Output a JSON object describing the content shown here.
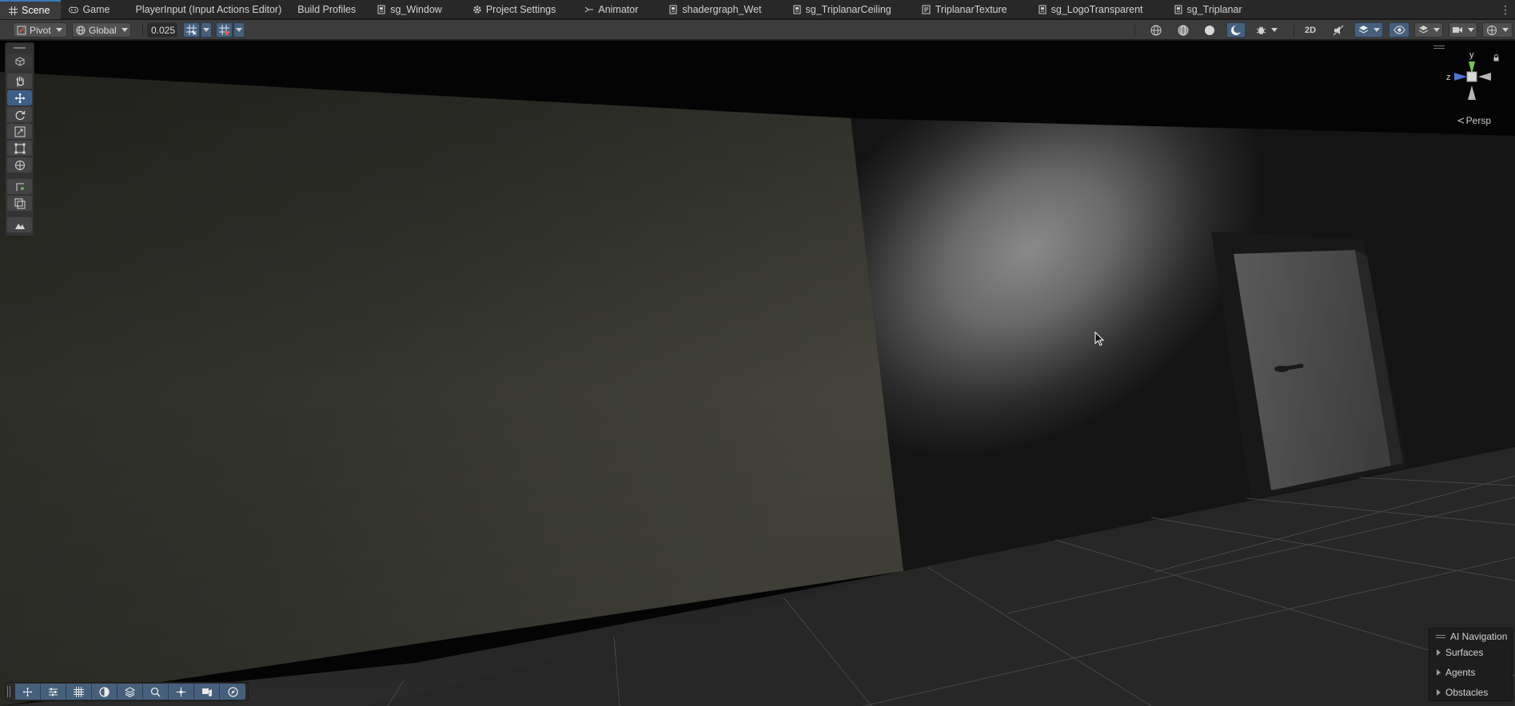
{
  "tabs": [
    {
      "label": "Scene",
      "icon": "scene-grid-icon",
      "active": true
    },
    {
      "label": "Game",
      "icon": "gamepad-icon",
      "active": false
    },
    {
      "label": "PlayerInput (Input Actions Editor)",
      "icon": "",
      "active": false
    },
    {
      "label": "Build Profiles",
      "icon": "",
      "active": false
    },
    {
      "label": "sg_Window",
      "icon": "shadergraph-icon",
      "active": false
    },
    {
      "label": "Project Settings",
      "icon": "gear-icon",
      "active": false
    },
    {
      "label": "Animator",
      "icon": "animator-icon",
      "active": false
    },
    {
      "label": "shadergraph_Wet",
      "icon": "shadergraph-icon",
      "active": false
    },
    {
      "label": "sg_TriplanarCeiling",
      "icon": "shadergraph-icon",
      "active": false
    },
    {
      "label": "TriplanarTexture",
      "icon": "subgraph-icon",
      "active": false
    },
    {
      "label": "sg_LogoTransparent",
      "icon": "shadergraph-icon",
      "active": false
    },
    {
      "label": "sg_Triplanar",
      "icon": "shadergraph-icon",
      "active": false
    }
  ],
  "toolbar": {
    "pivot_label": "Pivot",
    "space_label": "Global",
    "snap_increment_value": "0.025",
    "grid_snap_icon": "grid-snap-icon",
    "grid_visibility_icon": "grid-visibility-icon",
    "draw_mode_icons": [
      "wireframe-sphere-icon",
      "shaded-wireframe-icon",
      "shaded-sphere-icon",
      "lighting-sphere-icon"
    ],
    "right_icons": [
      "debug-bug-icon",
      "2d-toggle-icon",
      "audio-mute-icon",
      "effects-layers-icon",
      "visibility-eye-icon",
      "hidden-objects-icon",
      "camera-settings-icon",
      "gizmos-icon"
    ]
  },
  "tools": [
    "view-hand-icon",
    "move-arrows-icon",
    "rotate-icon",
    "scale-icon",
    "rect-transform-icon",
    "transform-all-icon",
    "custom-tool-icon",
    "component-tool-icon",
    "terrain-tool-icon"
  ],
  "gizmo": {
    "axis_y": "y",
    "axis_z": "z",
    "projection_label": "Persp"
  },
  "bottom_overlay": {
    "icons": [
      "move-snap-icon",
      "toggles-icon",
      "grid-icon",
      "lighting-icon",
      "layers-icon",
      "search-icon",
      "pivot-center-icon",
      "camera-preview-icon",
      "navigation-compass-icon"
    ]
  },
  "ai_navigation": {
    "title": "AI Navigation",
    "items": [
      "Surfaces",
      "Agents",
      "Obstacles"
    ]
  },
  "colors": {
    "accent": "#3a79bb",
    "button_blue": "#46607c",
    "toolbar_bg": "#3c3c3c",
    "tabbar_bg": "#282828"
  }
}
